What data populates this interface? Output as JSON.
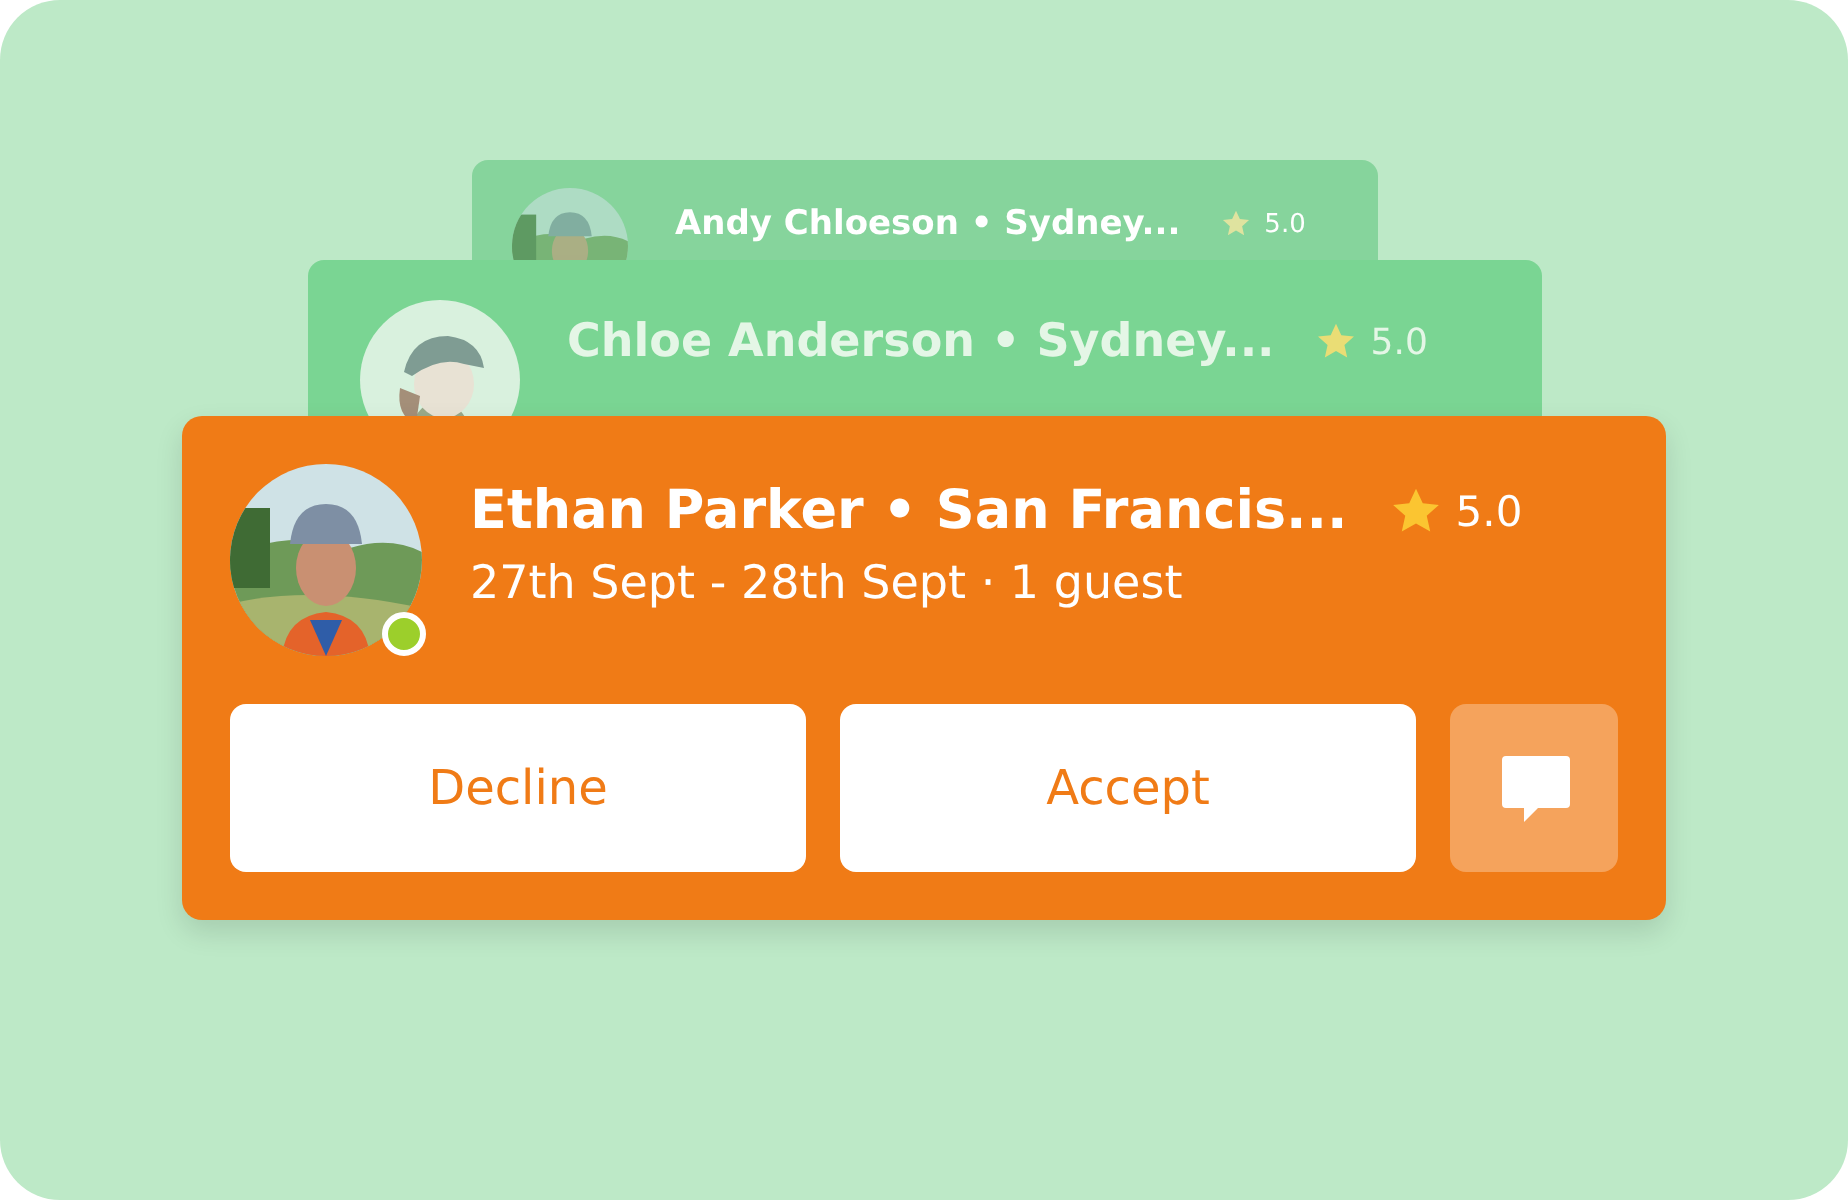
{
  "cards": [
    {
      "avatar": {
        "kind": "picture"
      },
      "name": "Andy Chloeson • Sydney...",
      "rating": "5.0"
    },
    {
      "avatar": {
        "kind": "drawing"
      },
      "name": "Chloe Anderson • Sydney...",
      "rating": "5.0"
    },
    {
      "avatar": {
        "kind": "picture"
      },
      "name": "Ethan Parker • San Francis...",
      "rating": "5.0",
      "dates": "27th Sept - 28th Sept · 1 guest",
      "online": true,
      "buttons": [
        "Decline",
        "Accept"
      ]
    }
  ]
}
